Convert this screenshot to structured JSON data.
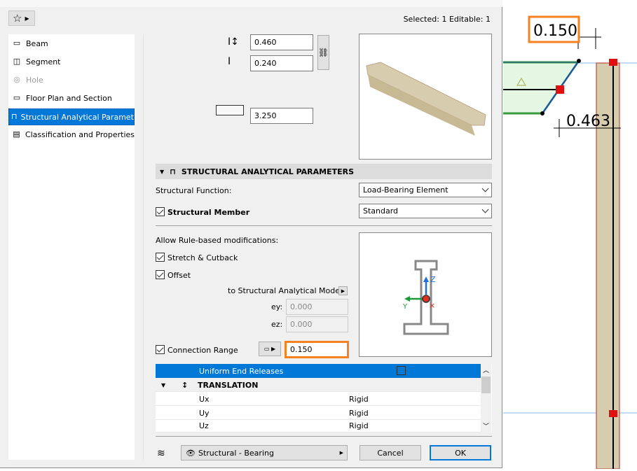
{
  "header": {
    "selection_info": "Selected: 1 Editable: 1"
  },
  "sidebar": {
    "items": [
      {
        "label": "Beam",
        "icon": "beam-icon"
      },
      {
        "label": "Segment",
        "icon": "segment-icon"
      },
      {
        "label": "Hole",
        "icon": "hole-icon",
        "disabled": true
      },
      {
        "label": "Floor Plan and Section",
        "icon": "floor-plan-icon"
      },
      {
        "label": "Structural Analytical Paramet...",
        "icon": "structural-icon",
        "selected": true
      },
      {
        "label": "Classification and Properties",
        "icon": "properties-icon"
      }
    ]
  },
  "geometry": {
    "height": "0.460",
    "width": "0.240",
    "length": "3.250"
  },
  "section": {
    "title": "STRUCTURAL ANALYTICAL PARAMETERS",
    "structural_function_label": "Structural Function:",
    "structural_function_value": "Load-Bearing Element",
    "structural_member_label": "Structural Member",
    "structural_member_value": "Standard",
    "rule_based_label": "Allow Rule-based modifications:",
    "stretch_label": "Stretch & Cutback",
    "offset_label": "Offset",
    "to_model_label": "to Structural Analytical Model",
    "ey_label": "ey:",
    "ey_value": "0.000",
    "ez_label": "ez:",
    "ez_value": "0.000",
    "connection_range_label": "Connection Range",
    "connection_range_value": "0.150",
    "axis_z": "Z",
    "axis_y": "Y"
  },
  "table": {
    "highlight_row": "Uniform End Releases",
    "group": "TRANSLATION",
    "rows": [
      {
        "name": "Ux",
        "value": "Rigid"
      },
      {
        "name": "Uy",
        "value": "Rigid"
      },
      {
        "name": "Uz",
        "value": "Rigid"
      }
    ]
  },
  "footer": {
    "layer": "Structural - Bearing",
    "cancel": "Cancel",
    "ok": "OK"
  },
  "canvas": {
    "dim_top": "0.150",
    "dim_side": "0.463"
  },
  "colors": {
    "accent": "#0078d7",
    "highlight": "#f58220",
    "beam_fill": "#d8ccae",
    "slab_fill": "#e3f7e3"
  }
}
